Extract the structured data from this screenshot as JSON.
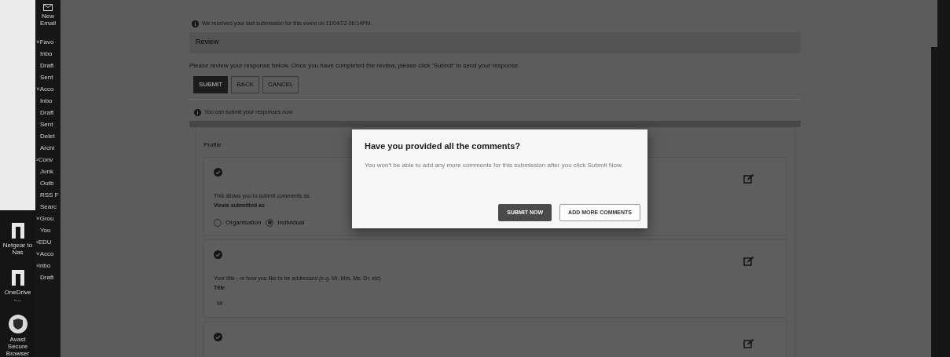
{
  "desktop_icons": [
    {
      "label": "Netgear to Nas",
      "kind": "folder"
    },
    {
      "label": "OneDrive -...",
      "kind": "folder"
    },
    {
      "label": "Avast Secure Browser",
      "kind": "browser"
    }
  ],
  "mail_nav": {
    "new_email": "New Email",
    "items": [
      {
        "label": "˅Favo",
        "kind": "group"
      },
      {
        "label": "Inbo",
        "kind": "folder"
      },
      {
        "label": "Draft",
        "kind": "folder"
      },
      {
        "label": "Sent",
        "kind": "folder"
      },
      {
        "label": "˅Acco",
        "kind": "group"
      },
      {
        "label": "Inbo",
        "kind": "folder"
      },
      {
        "label": "Draft",
        "kind": "folder"
      },
      {
        "label": "Sent",
        "kind": "folder"
      },
      {
        "label": "Delet",
        "kind": "folder"
      },
      {
        "label": "Archi",
        "kind": "folder"
      },
      {
        "label": "›Conv",
        "kind": "group"
      },
      {
        "label": "Junk",
        "kind": "folder"
      },
      {
        "label": "Outb",
        "kind": "folder"
      },
      {
        "label": "RSS F",
        "kind": "folder"
      },
      {
        "label": "Searc",
        "kind": "folder"
      },
      {
        "label": "˅Grou",
        "kind": "group"
      },
      {
        "label": "You",
        "kind": "folder"
      },
      {
        "label": "›EDU",
        "kind": "group"
      },
      {
        "label": "˅Acco",
        "kind": "group"
      },
      {
        "label": "›Inbo",
        "kind": "group"
      },
      {
        "label": "Draft",
        "kind": "folder"
      }
    ]
  },
  "notice": "We received your last submission for this event on 11/04/22 06:14PM.",
  "review": {
    "title": "Review",
    "instructions": "Please review your response below. Once you have completed the review, please click 'Submit' to send your response.",
    "buttons": [
      {
        "label": "SUBMIT",
        "kind": "primary"
      },
      {
        "label": "BACK",
        "kind": "outline"
      },
      {
        "label": "CANCEL",
        "kind": "outline"
      }
    ],
    "status": "You can submit your responses now"
  },
  "profile": {
    "title": "Profile",
    "questions": [
      {
        "prompt": "This allows you to submit comments as",
        "field_label": "Views submitted as",
        "kind": "radio",
        "options": [
          {
            "label": "Organisation",
            "selected": false
          },
          {
            "label": "Individual",
            "selected": true
          }
        ]
      },
      {
        "prompt": "Your title - or how you like to be addressed (e.g. Mr, Mrs, Ms, Dr, etc)",
        "field_label": "Title",
        "kind": "text",
        "value": "Mr"
      },
      {
        "kind": "empty"
      }
    ]
  },
  "dialog": {
    "title": "Have you provided all the comments?",
    "message": "You won't be able to add any more comments for this submission after you click Submit Now.",
    "buttons": [
      {
        "label": "SUBMIT NOW",
        "kind": "primary"
      },
      {
        "label": "ADD MORE COMMENTS",
        "kind": "outline"
      }
    ]
  }
}
